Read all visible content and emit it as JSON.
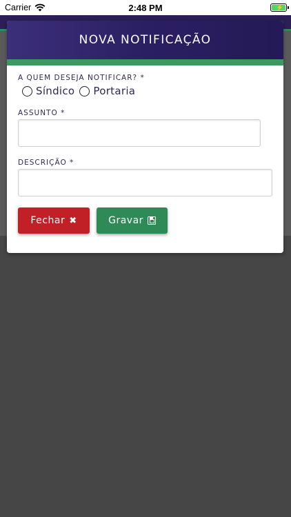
{
  "status_bar": {
    "carrier": "Carrier",
    "time": "2:48 PM"
  },
  "modal": {
    "title": "NOVA NOTIFICAÇÃO",
    "recipient_label": "A QUEM DESEJA NOTIFICAR? *",
    "recipient_options": [
      "Síndico",
      "Portaria"
    ],
    "subject_label": "ASSUNTO *",
    "subject_value": "",
    "description_label": "DESCRIÇÃO *",
    "description_value": "",
    "close_button": "Fechar",
    "save_button": "Gravar"
  },
  "colors": {
    "header": "#2b1f63",
    "accent_green": "#3a9a62",
    "close_red": "#c02026",
    "save_green": "#2e8b57",
    "backdrop": "#464646"
  }
}
